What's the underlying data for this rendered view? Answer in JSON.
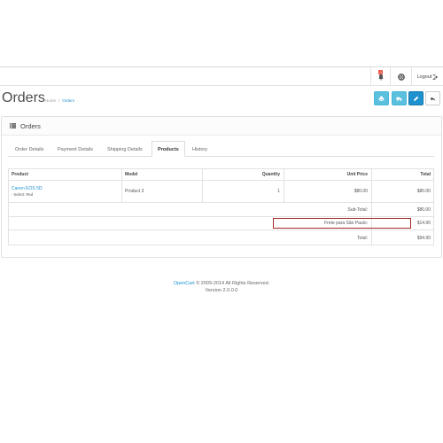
{
  "header": {
    "notification_count": "0",
    "logout_label": "Logout"
  },
  "page": {
    "title": "Orders",
    "breadcrumb": [
      "Home",
      "Orders"
    ]
  },
  "panel": {
    "title": "Orders"
  },
  "tabs": [
    "Order Details",
    "Payment Details",
    "Shipping Details",
    "Products",
    "History"
  ],
  "products_table": {
    "columns": [
      "Product",
      "Model",
      "Quantity",
      "Unit Price",
      "Total"
    ],
    "rows": [
      {
        "product": "Canon EOS 5D",
        "option": "- Select: Red",
        "model": "Product 3",
        "quantity": "1",
        "unit_price": "$80.00",
        "total": "$80.00"
      }
    ],
    "totals": [
      {
        "label": "Sub-Total:",
        "value": "$80.00"
      },
      {
        "label": "Frete para São Paulo:",
        "value": "$14.90"
      },
      {
        "label": "Total:",
        "value": "$94.90"
      }
    ]
  },
  "footer": {
    "brand": "OpenCart",
    "copyright": "© 2009-2014 All Rights Reserved.",
    "version": "Version 2.0.0.0"
  },
  "colors": {
    "primary": "#1e91cf",
    "info": "#5bc0de",
    "highlight_border": "#a52a2a",
    "badge": "#e74c3c"
  }
}
